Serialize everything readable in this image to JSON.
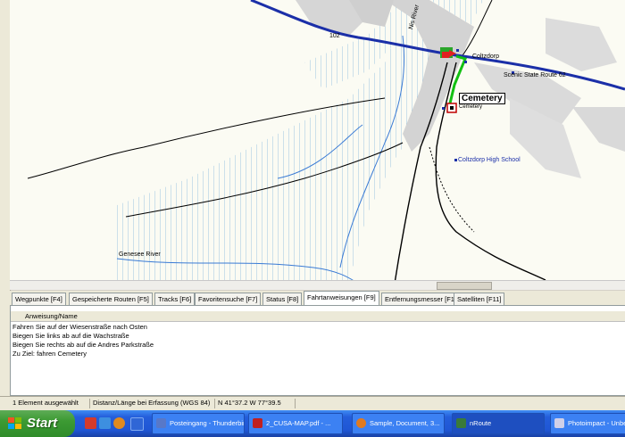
{
  "map": {
    "labels": {
      "road_102": "102",
      "river_n": "Nis River",
      "coltzdorp": "Coltzdorp",
      "scenic_route": "Scenic State Route 62",
      "cemetery": "Cemetery",
      "cemetery_sub": "Cemetery",
      "high_school": "Coltzdorp High School",
      "river_w": "Genesee River"
    }
  },
  "tabs": [
    {
      "label": "Wegpunkte [F4]",
      "active": false
    },
    {
      "label": "Gespeicherte Routen [F5]",
      "active": false
    },
    {
      "label": "Tracks [F6]",
      "active": false
    },
    {
      "label": "Favoritensuche [F7]",
      "active": false
    },
    {
      "label": "Status [F8]",
      "active": false
    },
    {
      "label": "Fahrtanweisungen [F9]",
      "active": true
    },
    {
      "label": "Entfernungsmesser [F10]",
      "active": false
    },
    {
      "label": "Satelliten [F11]",
      "active": false
    }
  ],
  "directions": {
    "column_header": "Anweisung/Name",
    "rows": [
      "Fahren Sie auf der Wiesenstraße nach Osten",
      "Biegen Sie links ab auf die Wachstraße",
      "Biegen Sie rechts ab auf die Andres Parkstraße",
      "Zu Ziel: fahren Cemetery"
    ]
  },
  "status": {
    "selected": "1 Element ausgewählt",
    "distance": "Distanz/Länge bei Erfassung (WGS 84)",
    "coords": "N 41°37.2  W 77°39.5"
  },
  "taskbar": {
    "start_label": "Start",
    "tasks": [
      {
        "label": "Posteingang - Thunderbird",
        "active": false
      },
      {
        "label": "2_CUSA-MAP.pdf - ...",
        "active": false
      },
      {
        "label": "Sample, Document, 3...",
        "active": false
      },
      {
        "label": "nRoute",
        "active": true
      },
      {
        "label": "Photoimpact - Unbe...",
        "active": false
      }
    ]
  },
  "colors": {
    "highway": "#1b2fa8",
    "route": "#12c012",
    "urban": "#d3d3d3",
    "hatch": "#9ec4e0",
    "taskbar": "#245edb"
  }
}
